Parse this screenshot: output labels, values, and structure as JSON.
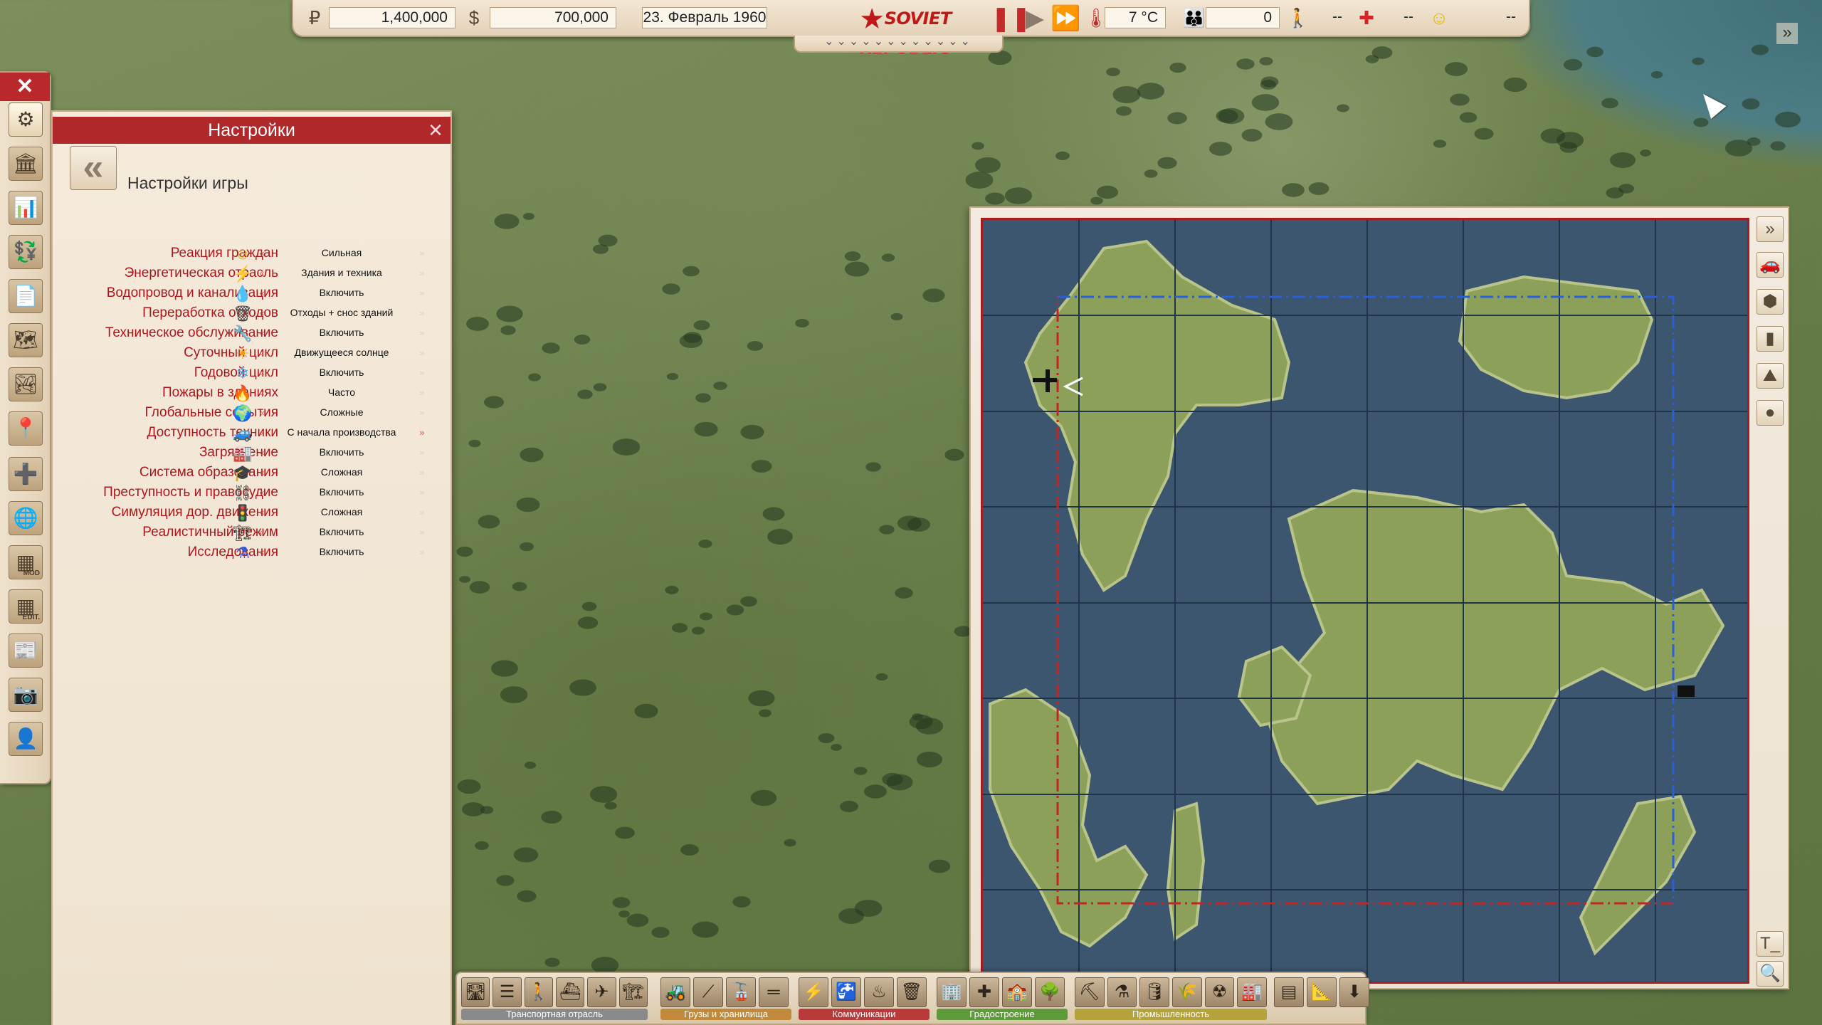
{
  "topbar": {
    "rubles": "1,400,000",
    "dollars": "700,000",
    "date": "23. Февраль 1960",
    "logo_text": "SOVIET REPUBLIC",
    "temperature": "7 °C",
    "population": "0",
    "workers": "--",
    "health": "--",
    "happiness": "--",
    "chevrons": "⌄⌄⌄⌄⌄⌄⌄⌄⌄⌄⌄⌄"
  },
  "left_toolbar": {
    "close_icon": "✕",
    "mod_label": "MOD",
    "edit_label": "EDIT."
  },
  "settings": {
    "title": "Настройки",
    "subtitle": "Настройки игры",
    "rows": [
      {
        "label": "Реакция граждан",
        "value": "Сильная",
        "icon": "smiley-icon"
      },
      {
        "label": "Энергетическая отрасль",
        "value": "Здания и техника",
        "icon": "lightning-icon"
      },
      {
        "label": "Водопровод и канализация",
        "value": "Включить",
        "icon": "water-drop-icon"
      },
      {
        "label": "Переработка отходов",
        "value": "Отходы + снос зданий",
        "icon": "trash-bin-icon"
      },
      {
        "label": "Техническое обслуживание",
        "value": "Включить",
        "icon": "wrench-icon"
      },
      {
        "label": "Суточный цикл",
        "value": "Движущееся солнце",
        "icon": "sun-icon"
      },
      {
        "label": "Годовой цикл",
        "value": "Включить",
        "icon": "snowflake-icon"
      },
      {
        "label": "Пожары в зданиях",
        "value": "Часто",
        "icon": "fire-icon"
      },
      {
        "label": "Глобальные события",
        "value": "Сложные",
        "icon": "globe-icon"
      },
      {
        "label": "Доступность техники",
        "value": "С начала производства",
        "icon": "vehicle-icon"
      },
      {
        "label": "Загрязнение",
        "value": "Включить",
        "icon": "factory-smoke-icon"
      },
      {
        "label": "Система образования",
        "value": "Сложная",
        "icon": "graduation-cap-icon"
      },
      {
        "label": "Преступность и правосудие",
        "value": "Включить",
        "icon": "handcuffs-icon"
      },
      {
        "label": "Симуляция дор. движения",
        "value": "Сложная",
        "icon": "traffic-light-icon"
      },
      {
        "label": "Реалистичный режим",
        "value": "Включить",
        "icon": "crane-icon"
      },
      {
        "label": "Исследования",
        "value": "Включить",
        "icon": "flask-icon"
      }
    ]
  },
  "minimap": {
    "top_right_chevron": "»",
    "text_button": "T_"
  },
  "bottom_toolbar": {
    "groups": [
      {
        "caption": "Транспортная отрасль",
        "color": "#8a8a8a"
      },
      {
        "caption": "Грузы и хранилища",
        "color": "#c08a3a"
      },
      {
        "caption": "Коммуникации",
        "color": "#b93a3a"
      },
      {
        "caption": "Градостроение",
        "color": "#5f9a3a"
      },
      {
        "caption": "Промышленность",
        "color": "#b5a23a"
      }
    ]
  }
}
